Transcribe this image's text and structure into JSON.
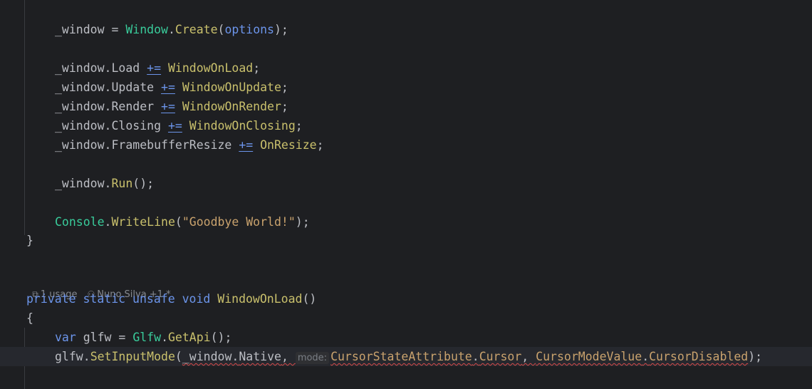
{
  "lines": {
    "l1": {
      "var": "_window",
      "eq": " = ",
      "cls": "Window",
      "dot": ".",
      "mth": "Create",
      "open": "(",
      "arg": "options",
      "close": ");"
    },
    "l2": {
      "obj": "_window",
      "dot": ".",
      "fld": "Load",
      "sp": " ",
      "op": "+=",
      "sp2": " ",
      "fn": "WindowOnLoad",
      "end": ";"
    },
    "l3": {
      "obj": "_window",
      "dot": ".",
      "fld": "Update",
      "sp": " ",
      "op": "+=",
      "sp2": " ",
      "fn": "WindowOnUpdate",
      "end": ";"
    },
    "l4": {
      "obj": "_window",
      "dot": ".",
      "fld": "Render",
      "sp": " ",
      "op": "+=",
      "sp2": " ",
      "fn": "WindowOnRender",
      "end": ";"
    },
    "l5": {
      "obj": "_window",
      "dot": ".",
      "fld": "Closing",
      "sp": " ",
      "op": "+=",
      "sp2": " ",
      "fn": "WindowOnClosing",
      "end": ";"
    },
    "l6": {
      "obj": "_window",
      "dot": ".",
      "fld": "FramebufferResize",
      "sp": " ",
      "op": "+=",
      "sp2": " ",
      "fn": "OnResize",
      "end": ";"
    },
    "l7": {
      "obj": "_window",
      "dot": ".",
      "fn": "Run",
      "end": "();"
    },
    "l8": {
      "cls": "Console",
      "dot": ".",
      "mth": "WriteLine",
      "open": "(",
      "str": "\"Goodbye World!\"",
      "close": ");"
    },
    "l9": {
      "brace": "}"
    },
    "l10": {
      "kw1": "private",
      "kw2": "static",
      "kw3": "unsafe",
      "kw4": "void",
      "fn": "WindowOnLoad",
      "paren": "()"
    },
    "l11": {
      "brace": "{"
    },
    "l12": {
      "kw": "var",
      "var": "glfw",
      "eq": " = ",
      "cls": "Glfw",
      "dot": ".",
      "mth": "GetApi",
      "end": "();"
    },
    "l13": {
      "obj": "glfw",
      "dot": ".",
      "mth": "SetInputMode",
      "open": "(",
      "arg1": "_window",
      "dot2": ".",
      "arg1b": "Native",
      "comma": ", ",
      "hint": "mode:",
      "cls2": "CursorStateAttribute",
      "dot3": ".",
      "fld2": "Cursor",
      "comma2": ", ",
      "cls3": "CursorModeValue",
      "dot4": ".",
      "fld3": "CursorDisabled",
      "close": ");"
    }
  },
  "codelens": {
    "usage_icon": "external-link-icon",
    "usages": "1 usage",
    "author_icon": "person-icon",
    "author": "Nuno Silva +1 *"
  },
  "colors": {
    "background": "#1e1f22",
    "keyword": "#6c95eb",
    "class": "#39cc9b",
    "method": "#c9c06c",
    "string": "#c9a26d",
    "text": "#bcbec4"
  }
}
